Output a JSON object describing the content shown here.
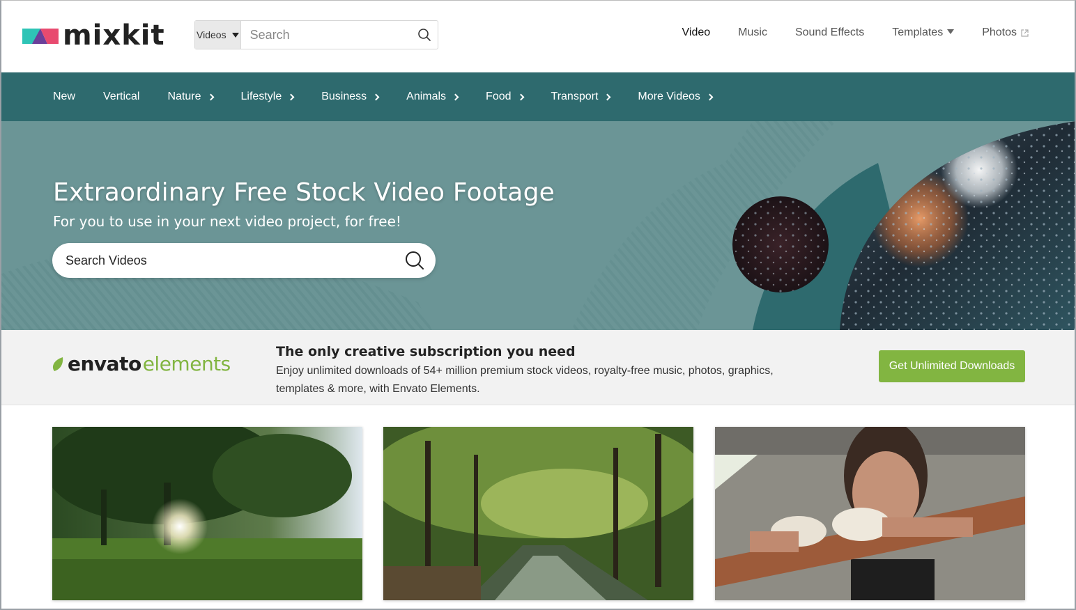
{
  "header": {
    "logo_text": "mixkit",
    "search_scope": "Videos",
    "search_placeholder": "Search",
    "nav": [
      {
        "label": "Video",
        "active": true
      },
      {
        "label": "Music"
      },
      {
        "label": "Sound Effects"
      },
      {
        "label": "Templates",
        "has_dropdown": true
      },
      {
        "label": "Photos",
        "external": true
      }
    ]
  },
  "categories": [
    {
      "label": "New"
    },
    {
      "label": "Vertical"
    },
    {
      "label": "Nature",
      "chevron": true
    },
    {
      "label": "Lifestyle",
      "chevron": true
    },
    {
      "label": "Business",
      "chevron": true
    },
    {
      "label": "Animals",
      "chevron": true
    },
    {
      "label": "Food",
      "chevron": true
    },
    {
      "label": "Transport",
      "chevron": true
    },
    {
      "label": "More Videos",
      "chevron": true
    }
  ],
  "hero": {
    "title": "Extraordinary Free Stock Video Footage",
    "subtitle": "For you to use in your next video project, for free!",
    "search_placeholder": "Search Videos"
  },
  "envato": {
    "logo_word1": "envato",
    "logo_word2": "elements",
    "title": "The only creative subscription you need",
    "description": "Enjoy unlimited downloads of 54+ million premium stock videos, royalty-free music, photos, graphics, templates & more, with Envato Elements.",
    "cta_label": "Get Unlimited Downloads"
  },
  "thumbnails": [
    {
      "subject": "sun shining through trees in a park"
    },
    {
      "subject": "stream running through a green forest"
    },
    {
      "subject": "boxer with wrapped hands resting on ropes"
    }
  ],
  "colors": {
    "category_bar": "#2e6a6e",
    "hero_bg": "#6b9596",
    "accent_green": "#82b541",
    "logo_teal": "#2ec4b6",
    "logo_pink": "#e84a6f",
    "logo_purple": "#6b3f9a"
  },
  "icons": {
    "search": "search-icon",
    "dropdown": "triangle-down-icon",
    "external": "external-link-icon",
    "chevron": "chevron-right-icon"
  }
}
